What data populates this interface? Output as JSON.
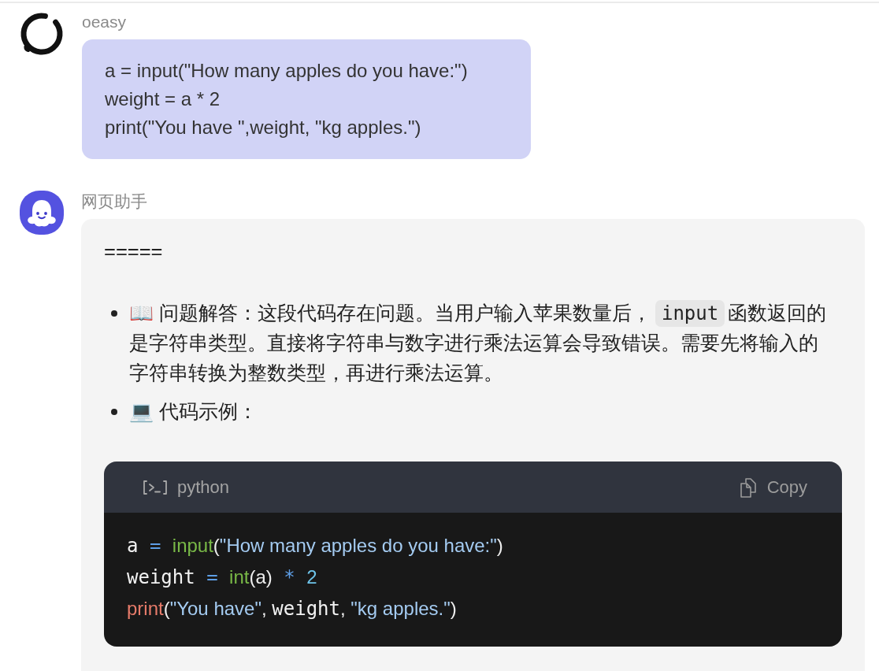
{
  "messages": [
    {
      "kind": "user",
      "sender": "oeasy",
      "lines": [
        "a = input(\"How many apples do you have:\")",
        "weight = a * 2",
        "print(\"You have \",weight, \"kg apples.\")"
      ]
    },
    {
      "kind": "assistant",
      "sender": "网页助手",
      "divider": "=====",
      "bullets": [
        {
          "segments": [
            {
              "kind": "text",
              "text": "📖 问题解答：这段代码存在问题。当用户输入苹果数量后，"
            },
            {
              "kind": "code",
              "text": "input"
            },
            {
              "kind": "text",
              "text": "函数返回的是字符串类型。直接将字符串与数字进行乘法运算会导致错误。需要先将输入的字符串转换为整数类型，再进行乘法运算。"
            }
          ]
        },
        {
          "segments": [
            {
              "kind": "text",
              "text": "💻 代码示例："
            }
          ]
        }
      ],
      "code_block": {
        "language": "python",
        "copy_label": "Copy",
        "lines": [
          [
            {
              "kind": "variable",
              "text": "a"
            },
            {
              "kind": "operator",
              "text": " = "
            },
            {
              "kind": "builtin",
              "text": "input"
            },
            {
              "kind": "punctuation",
              "text": "("
            },
            {
              "kind": "string",
              "text": "\"How many apples do you have:\""
            },
            {
              "kind": "punctuation",
              "text": ")"
            }
          ],
          [
            {
              "kind": "variable",
              "text": "weight"
            },
            {
              "kind": "operator",
              "text": " = "
            },
            {
              "kind": "builtin",
              "text": "int"
            },
            {
              "kind": "punctuation",
              "text": "(a)"
            },
            {
              "kind": "operator",
              "text": " * "
            },
            {
              "kind": "number",
              "text": "2"
            }
          ],
          [
            {
              "kind": "keyword",
              "text": "print"
            },
            {
              "kind": "punctuation",
              "text": "("
            },
            {
              "kind": "string",
              "text": "\"You have\""
            },
            {
              "kind": "punctuation",
              "text": ", "
            },
            {
              "kind": "variable",
              "text": "weight"
            },
            {
              "kind": "punctuation",
              "text": ", "
            },
            {
              "kind": "string",
              "text": "\"kg apples.\""
            },
            {
              "kind": "punctuation",
              "text": ")"
            }
          ]
        ]
      }
    }
  ]
}
